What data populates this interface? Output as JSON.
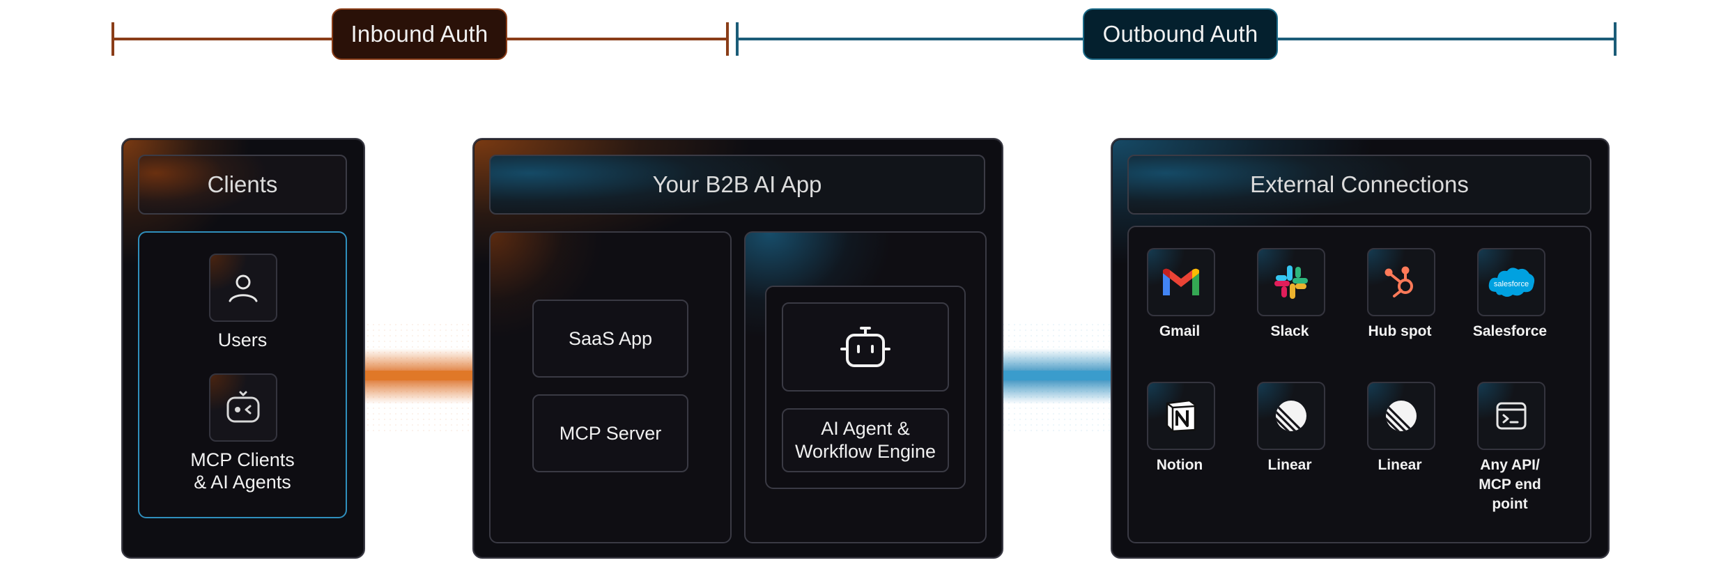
{
  "auth": {
    "inbound_label": "Inbound Auth",
    "outbound_label": "Outbound Auth"
  },
  "colors": {
    "inbound": "#8a3d18",
    "outbound": "#1b5c78",
    "panel_bg": "#0d0d12"
  },
  "clients": {
    "title": "Clients",
    "items": [
      {
        "label": "Users",
        "icon": "user-icon"
      },
      {
        "label_line1": "MCP Clients",
        "label_line2": "& AI Agents",
        "icon": "robot-face-icon"
      }
    ]
  },
  "app": {
    "title": "Your B2B AI App",
    "left_cards": [
      "SaaS App",
      "MCP Server"
    ],
    "agent": {
      "icon": "robot-icon",
      "label_line1": "AI Agent &",
      "label_line2": "Workflow Engine"
    }
  },
  "external": {
    "title": "External Connections",
    "connections": [
      {
        "label": "Gmail",
        "icon": "gmail-icon"
      },
      {
        "label": "Slack",
        "icon": "slack-icon"
      },
      {
        "label": "Hub spot",
        "icon": "hubspot-icon"
      },
      {
        "label": "Salesforce",
        "icon": "salesforce-icon",
        "logo_text": "salesforce"
      },
      {
        "label": "Notion",
        "icon": "notion-icon"
      },
      {
        "label": "Linear",
        "icon": "linear-icon"
      },
      {
        "label": "Linear",
        "icon": "linear-icon"
      },
      {
        "label_line1": "Any API/",
        "label_line2": "MCP end",
        "label_line3": "point",
        "icon": "terminal-window-icon"
      }
    ]
  }
}
